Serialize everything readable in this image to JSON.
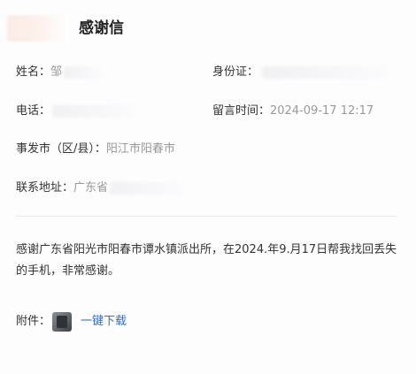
{
  "header": {
    "title": "感谢信"
  },
  "fields": {
    "name_label": "姓名：",
    "name_value": "邹",
    "id_label": "身份证：",
    "phone_label": "电话：",
    "time_label": "留言时间：",
    "time_value": "2024-09-17 12:17",
    "city_label": "事发市（区/县）：",
    "city_value": "阳江市阳春市",
    "address_label": "联系地址：",
    "address_value": "广东省"
  },
  "message": {
    "body": "感谢广东省阳光市阳春市谭水镇派出所，在2024.年9.月17日帮我找回丢失的手机，非常感谢。"
  },
  "attachment": {
    "label": "附件：",
    "thumb_icon": "image-thumbnail-icon",
    "download_label": "一键下载"
  },
  "colors": {
    "link": "#2a6fdb",
    "muted": "#999999",
    "text": "#333333"
  }
}
